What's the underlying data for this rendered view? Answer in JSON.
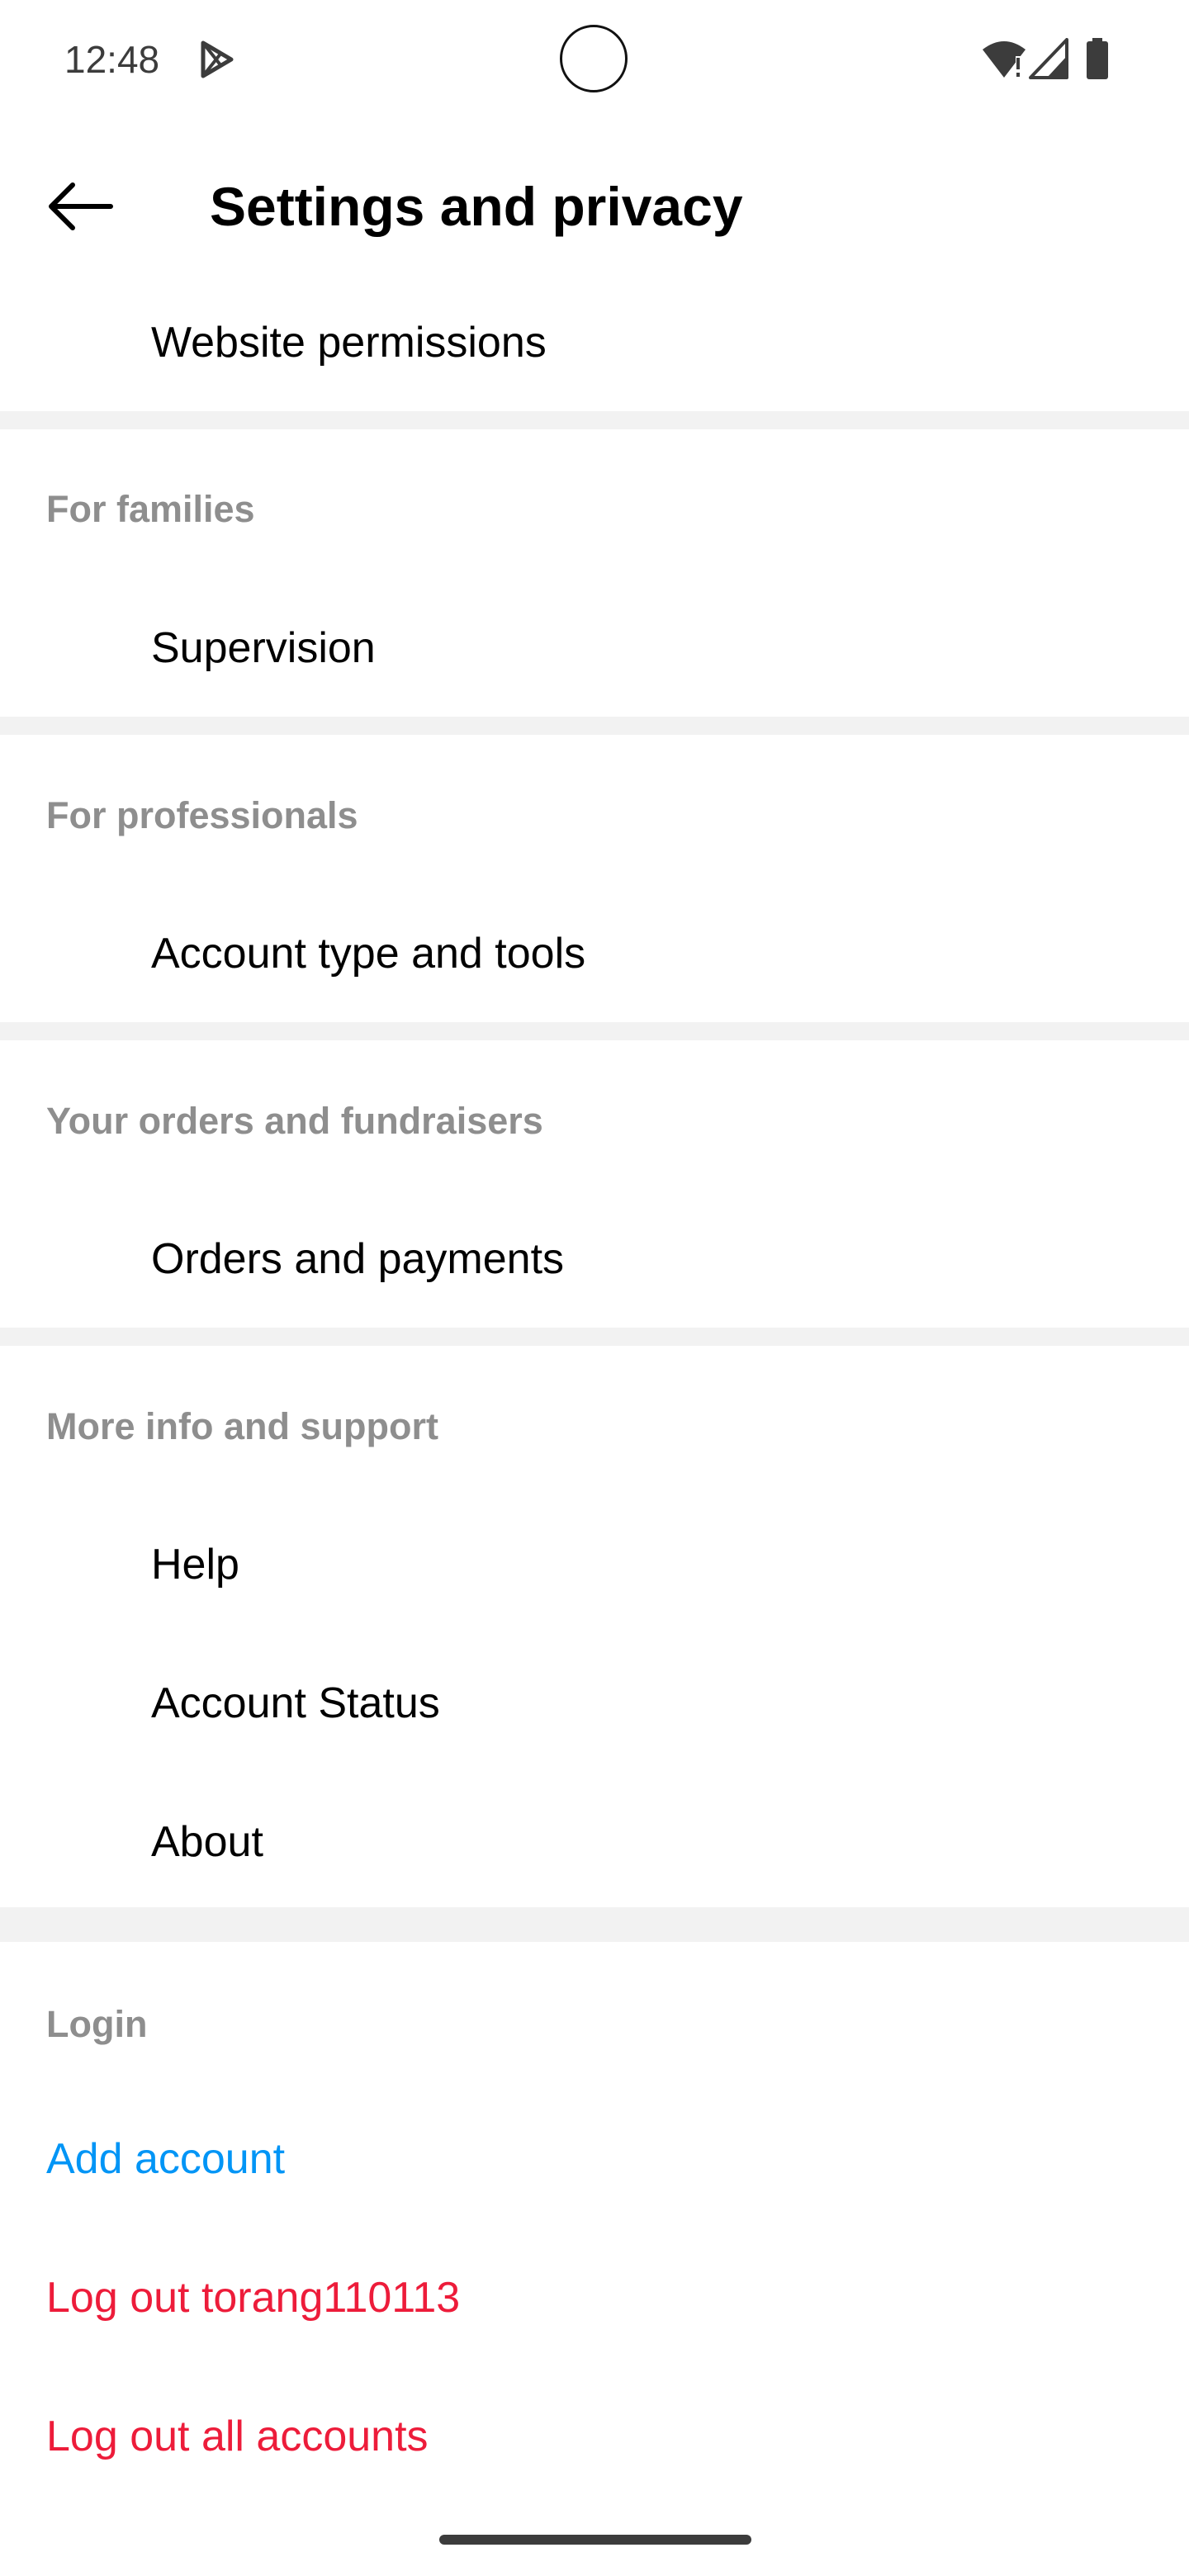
{
  "status_bar": {
    "time": "12:48",
    "icons": [
      "play-store-icon",
      "wifi-alert-icon",
      "cell-signal-icon",
      "battery-icon"
    ]
  },
  "app_bar": {
    "back_icon": "arrow-left-icon",
    "title": "Settings and privacy"
  },
  "top_item": {
    "label": "Website permissions"
  },
  "sections": {
    "families": {
      "header": "For families",
      "items": [
        "Supervision"
      ]
    },
    "professionals": {
      "header": "For professionals",
      "items": [
        "Account type and tools"
      ]
    },
    "orders": {
      "header": "Your orders and fundraisers",
      "items": [
        "Orders and payments"
      ]
    },
    "support": {
      "header": "More info and support",
      "items": [
        "Help",
        "Account Status",
        "About"
      ]
    },
    "login": {
      "header": "Login",
      "add_account": "Add account",
      "log_out_user": "Log out torang110113",
      "log_out_all": "Log out all accounts"
    }
  },
  "colors": {
    "link_blue": "#0095f6",
    "danger_red": "#ed1c3a",
    "section_header_grey": "#8e8e8e",
    "divider_grey": "#f2f2f2"
  }
}
